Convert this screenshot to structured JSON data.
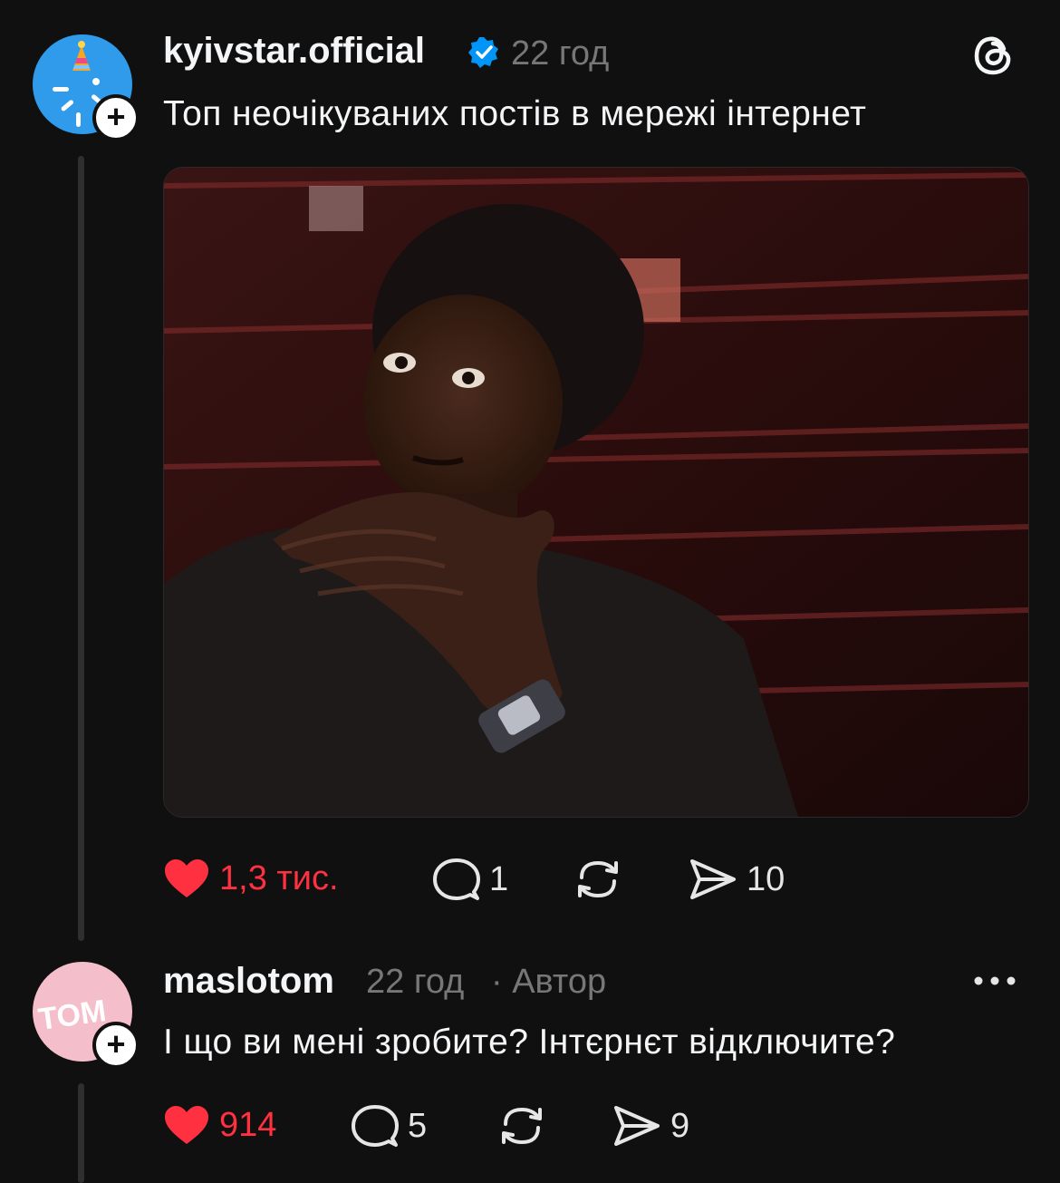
{
  "post": {
    "username": "kyivstar.official",
    "time": "22 год",
    "text": "Топ неочікуваних постів в мережі інтернет",
    "actions": {
      "likes": "1,3 тис.",
      "comments": "1",
      "shares": "10"
    },
    "liked": true
  },
  "reply": {
    "username": "maslotom",
    "time": "22 год",
    "author_badge": "· Автор",
    "avatar_text": "TOM",
    "text": "І що ви мені зробите? Інтєрнєт відключите?",
    "actions": {
      "likes": "914",
      "comments": "5",
      "shares": "9"
    },
    "liked": true
  },
  "colors": {
    "background": "#101010",
    "like_red": "#ff3040",
    "verified_blue": "#0095f6",
    "kyivstar_blue": "#2f9bea",
    "tom_pink": "#f4bfcb"
  },
  "icons": [
    "verified-icon",
    "threads-logo-icon",
    "heart-icon",
    "comment-icon",
    "repost-icon",
    "send-icon",
    "more-icon",
    "plus-icon"
  ]
}
